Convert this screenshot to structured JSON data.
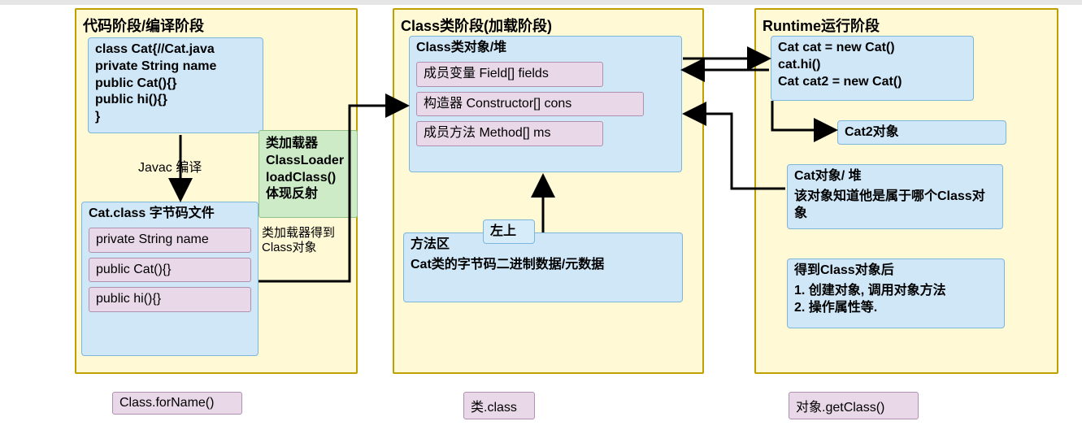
{
  "stages": {
    "compile": {
      "title": "代码阶段/编译阶段"
    },
    "classstage": {
      "title": "Class类阶段(加载阶段)"
    },
    "runtime": {
      "title": "Runtime运行阶段"
    }
  },
  "compile": {
    "source_box_lines": {
      "l1": "class Cat{//Cat.java",
      "l2": "private String name",
      "l3": "public Cat(){}",
      "l4": "public hi(){}",
      "l5": "}"
    },
    "javac_label": "Javac 编译",
    "bytecode_box": {
      "title": "Cat.class 字节码文件",
      "chips": {
        "c1": "private String name",
        "c2": "public Cat(){}",
        "c3": "public hi(){}"
      }
    },
    "footer_chip": "Class.forName()"
  },
  "loader_box": {
    "l1": "类加载器",
    "l2": "ClassLoader",
    "l3": "loadClass()",
    "l4": "体现反射"
  },
  "loader_note": "类加载器得到Class对象",
  "classstage": {
    "heap_box": {
      "title": "Class类对象/堆",
      "chips": {
        "c1": "成员变量 Field[] fields",
        "c2": "构造器 Constructor[] cons",
        "c3": "成员方法 Method[] ms"
      }
    },
    "method_area_box": {
      "title": "方法区",
      "body": "Cat类的字节码二进制数据/元数据"
    },
    "sticky": "左上",
    "footer_chip": "类.class"
  },
  "runtime": {
    "code_box": {
      "l1": "Cat cat = new Cat()",
      "l2": "cat.hi()",
      "l3": "Cat cat2 = new Cat()"
    },
    "cat2_box": "Cat2对象",
    "catobj_box": {
      "title": "Cat对象/ 堆",
      "body": "该对象知道他是属于哪个Class对象"
    },
    "after_box": {
      "title": "得到Class对象后",
      "l1": "1. 创建对象, 调用对象方法",
      "l2": "2. 操作属性等."
    },
    "footer_chip": "对象.getClass()"
  }
}
